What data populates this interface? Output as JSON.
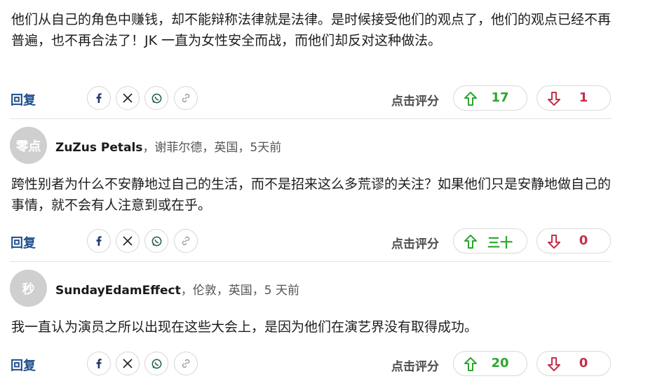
{
  "comments": [
    {
      "body": "他们从自己的角色中赚钱，却不能辩称法律就是法律。是时候接受他们的观点了，他们的观点已经不再普遍，也不再合法了！JK 一直为女性安全而战，而他们却反对这种做法。",
      "reply_label": "回复",
      "rate_label": "点击评分",
      "up_count": "17",
      "down_count": "1"
    },
    {
      "avatar": "零点",
      "name": "ZuZus Petals",
      "meta": "，谢菲尔德，英国，5天前",
      "body": "跨性别者为什么不安静地过自己的生活，而不是招来这么多荒谬的关注？如果他们只是安静地做自己的事情，就不会有人注意到或在乎。",
      "reply_label": "回复",
      "rate_label": "点击评分",
      "up_count": "三十",
      "down_count": "0"
    },
    {
      "avatar": "秒",
      "name": "SundayEdamEffect",
      "meta": "，伦敦，英国，5 天前",
      "body": "我一直认为演员之所以出现在这些大会上，是因为他们在演艺界没有取得成功。",
      "reply_label": "回复",
      "rate_label": "点击评分",
      "up_count": "20",
      "down_count": "0"
    }
  ],
  "share_icons": [
    "facebook-icon",
    "x-twitter-icon",
    "whatsapp-icon",
    "link-icon"
  ],
  "colors": {
    "reply": "#1f4f8c",
    "upvote": "#2ea52e",
    "downvote": "#c42f4a",
    "avatar_bg": "#cfcfcf"
  }
}
